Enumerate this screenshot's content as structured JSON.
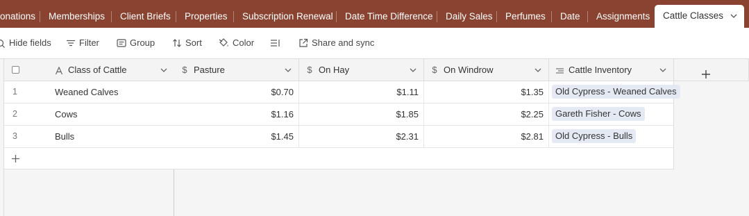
{
  "tabs": [
    {
      "label": "onations"
    },
    {
      "label": "Memberships"
    },
    {
      "label": "Client Briefs"
    },
    {
      "label": "Properties"
    },
    {
      "label": "Subscription Renewal"
    },
    {
      "label": "Date Time Difference"
    },
    {
      "label": "Daily Sales"
    },
    {
      "label": "Perfumes"
    },
    {
      "label": "Date"
    },
    {
      "label": "Assignments"
    }
  ],
  "active_tab": {
    "label": "Cattle Classes"
  },
  "toolbar": {
    "hide_fields": "Hide fields",
    "filter": "Filter",
    "group": "Group",
    "sort": "Sort",
    "color": "Color",
    "share": "Share and sync"
  },
  "columns": {
    "primary": "Class of Cattle",
    "pasture": "Pasture",
    "on_hay": "On Hay",
    "on_windrow": "On Windrow",
    "inventory": "Cattle Inventory"
  },
  "rows": [
    {
      "num": "1",
      "name": "Weaned Calves",
      "pasture": "$0.70",
      "on_hay": "$1.11",
      "on_windrow": "$1.35",
      "inventory": "Old Cypress - Weaned Calves"
    },
    {
      "num": "2",
      "name": "Cows",
      "pasture": "$1.16",
      "on_hay": "$1.85",
      "on_windrow": "$2.25",
      "inventory": "Gareth Fisher - Cows"
    },
    {
      "num": "3",
      "name": "Bulls",
      "pasture": "$1.45",
      "on_hay": "$2.31",
      "on_windrow": "$2.81",
      "inventory": "Old Cypress - Bulls"
    }
  ],
  "colors": {
    "tabbar": "#8a4330",
    "pill": "#e4e9f4"
  }
}
